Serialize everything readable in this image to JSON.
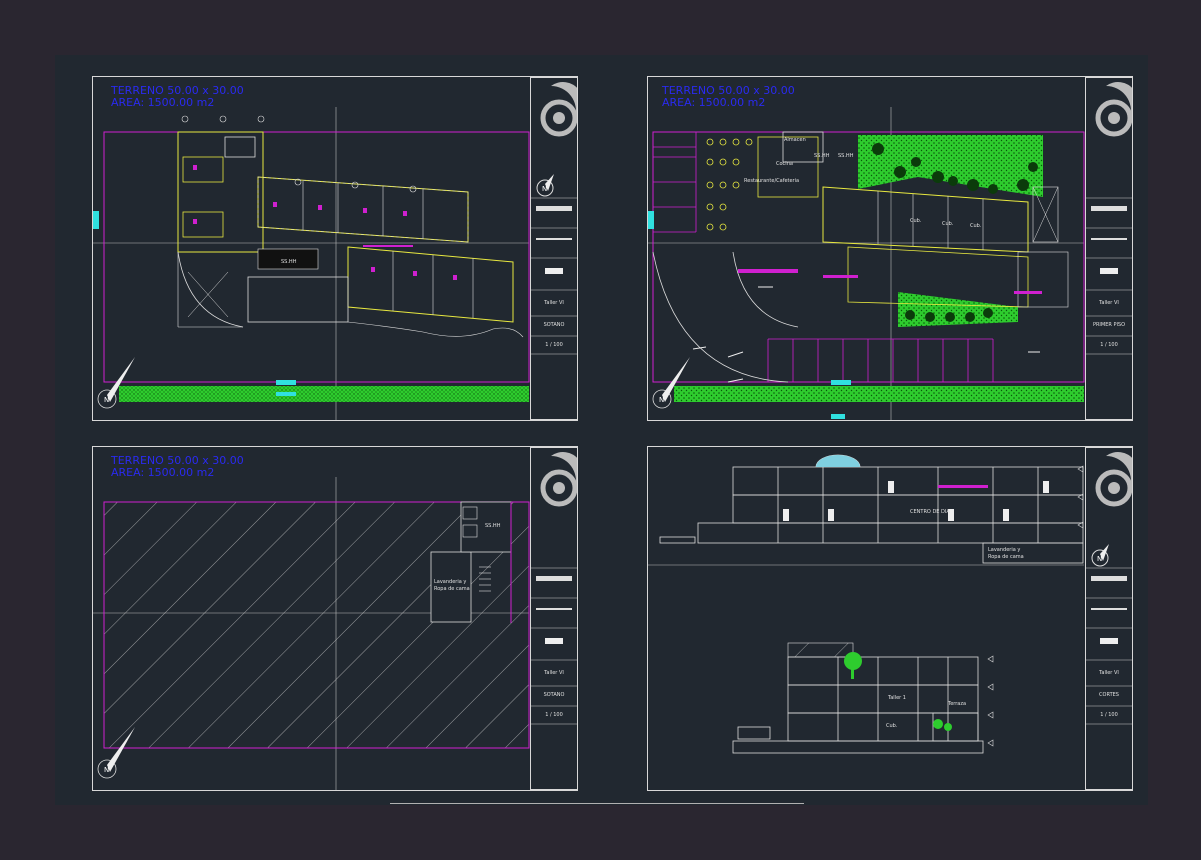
{
  "sheets": {
    "tl": {
      "terreno": "TERRENO 50.00 x 30.00",
      "area": "AREA: 1500.00 m2",
      "labels": {
        "ssh": "SS.HH"
      },
      "title_block": {
        "taller": "Taller VI",
        "name": "SOTANO",
        "scale": "1 / 100"
      }
    },
    "tr": {
      "terreno": "TERRENO 50.00 x 30.00",
      "area": "AREA: 1500.00 m2",
      "labels": {
        "almacen": "Almacen",
        "cocina": "Cocina",
        "ssh1": "SS.HH",
        "ssh2": "SS.HH",
        "restaurante": "Restaurante/Cafeteria",
        "cub1": "Cub.",
        "cub2": "Cub.",
        "cub3": "Cub."
      },
      "title_block": {
        "taller": "Taller VI",
        "name": "PRIMER PISO",
        "scale": "1 / 100"
      }
    },
    "bl": {
      "terreno": "TERRENO 50.00 x 30.00",
      "area": "AREA: 1500.00 m2",
      "labels": {
        "ssh": "SS.HH",
        "lavanderia_1": "Lavanderia y",
        "lavanderia_2": "Ropa de cama"
      },
      "title_block": {
        "taller": "Taller VI",
        "name": "SOTANO",
        "scale": "1 / 100"
      }
    },
    "br": {
      "labels": {
        "centro": "CENTRO DE DIA",
        "lav_1": "Lavanderia y",
        "lav_2": "Ropa de cama",
        "taller1": "Taller 1",
        "terraza": "Terraza",
        "cub": "Cub."
      },
      "title_block": {
        "taller": "Taller VI",
        "name": "CORTES",
        "scale": "1 / 100"
      }
    }
  },
  "colors": {
    "frame": "#d8d8d8",
    "magenta": "#d020d0",
    "yellow": "#e8e840",
    "cyan": "#30e0e0",
    "green": "#2ecc2e",
    "blue_text": "#2a2af0",
    "bg": "#212830"
  }
}
